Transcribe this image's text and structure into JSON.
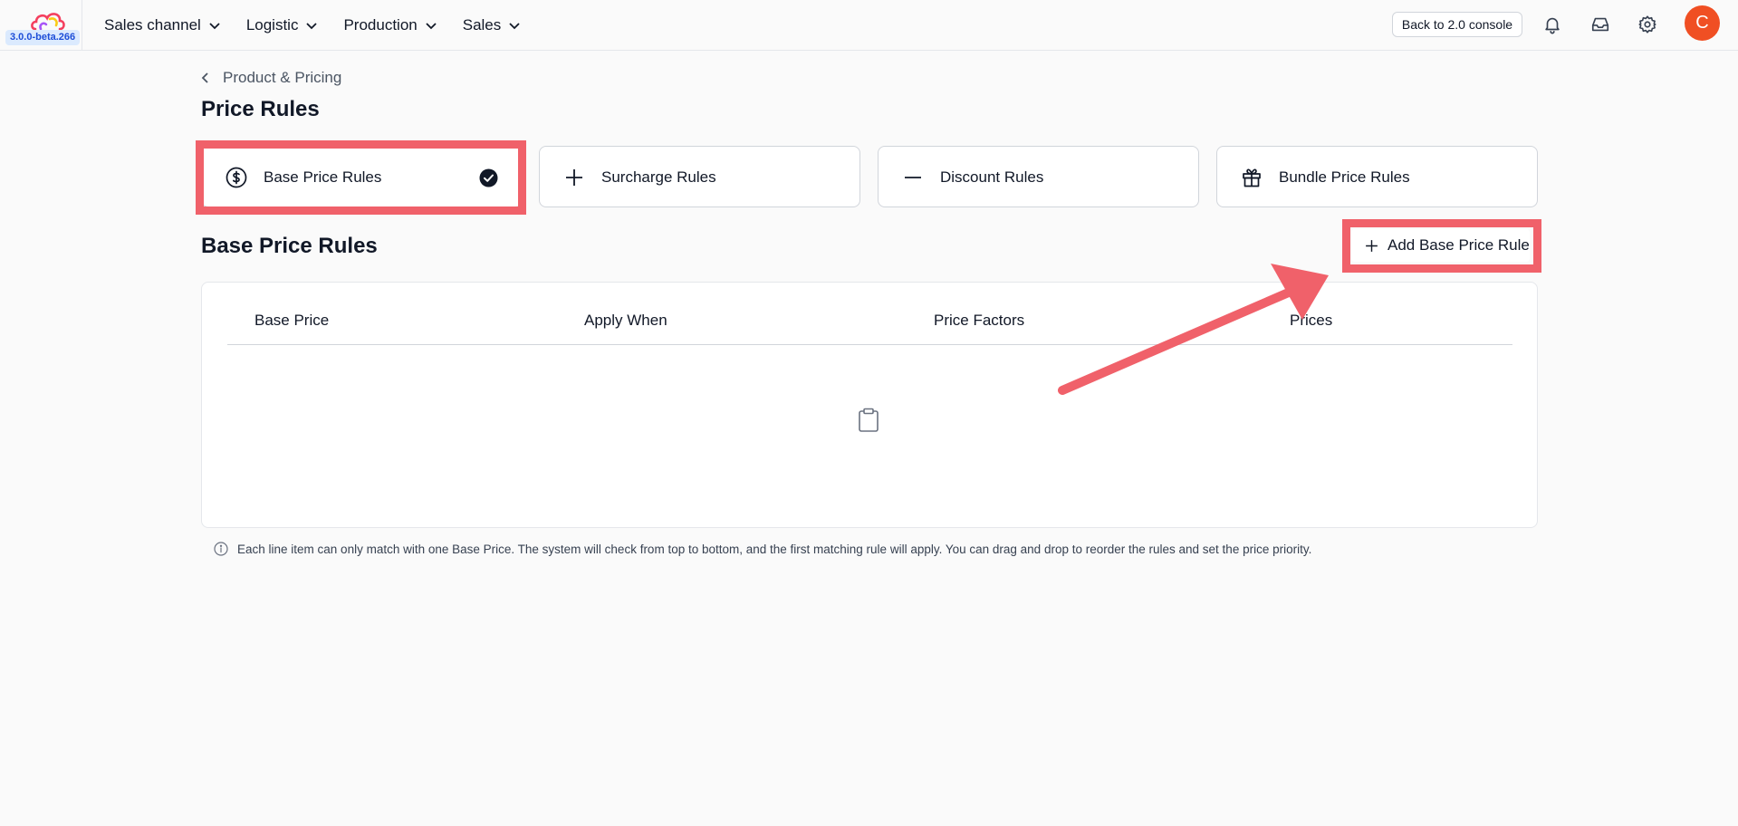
{
  "header": {
    "version": "3.0.0-beta.266",
    "nav": [
      {
        "label": "Sales channel"
      },
      {
        "label": "Logistic"
      },
      {
        "label": "Production"
      },
      {
        "label": "Sales"
      }
    ],
    "back_button": "Back to 2.0 console",
    "avatar_initial": "C"
  },
  "breadcrumb": {
    "label": "Product & Pricing"
  },
  "page_title": "Price Rules",
  "tabs": [
    {
      "label": "Base Price Rules",
      "icon": "dollar-circle-icon",
      "selected": true
    },
    {
      "label": "Surcharge Rules",
      "icon": "plus-icon",
      "selected": false
    },
    {
      "label": "Discount Rules",
      "icon": "minus-icon",
      "selected": false
    },
    {
      "label": "Bundle Price Rules",
      "icon": "gift-icon",
      "selected": false
    }
  ],
  "section": {
    "title": "Base Price Rules",
    "add_button": "Add Base Price Rule"
  },
  "table": {
    "columns": [
      "Base Price",
      "Apply When",
      "Price Factors",
      "Prices"
    ],
    "rows": []
  },
  "info_note": "Each line item can only match with one Base Price. The system will check from top to bottom, and the first matching rule will apply. You can drag and drop to reorder the rules and set the price priority.",
  "colors": {
    "accent_highlight": "#f0616a",
    "avatar": "#f04f23",
    "version_badge_bg": "#dbeafe"
  }
}
